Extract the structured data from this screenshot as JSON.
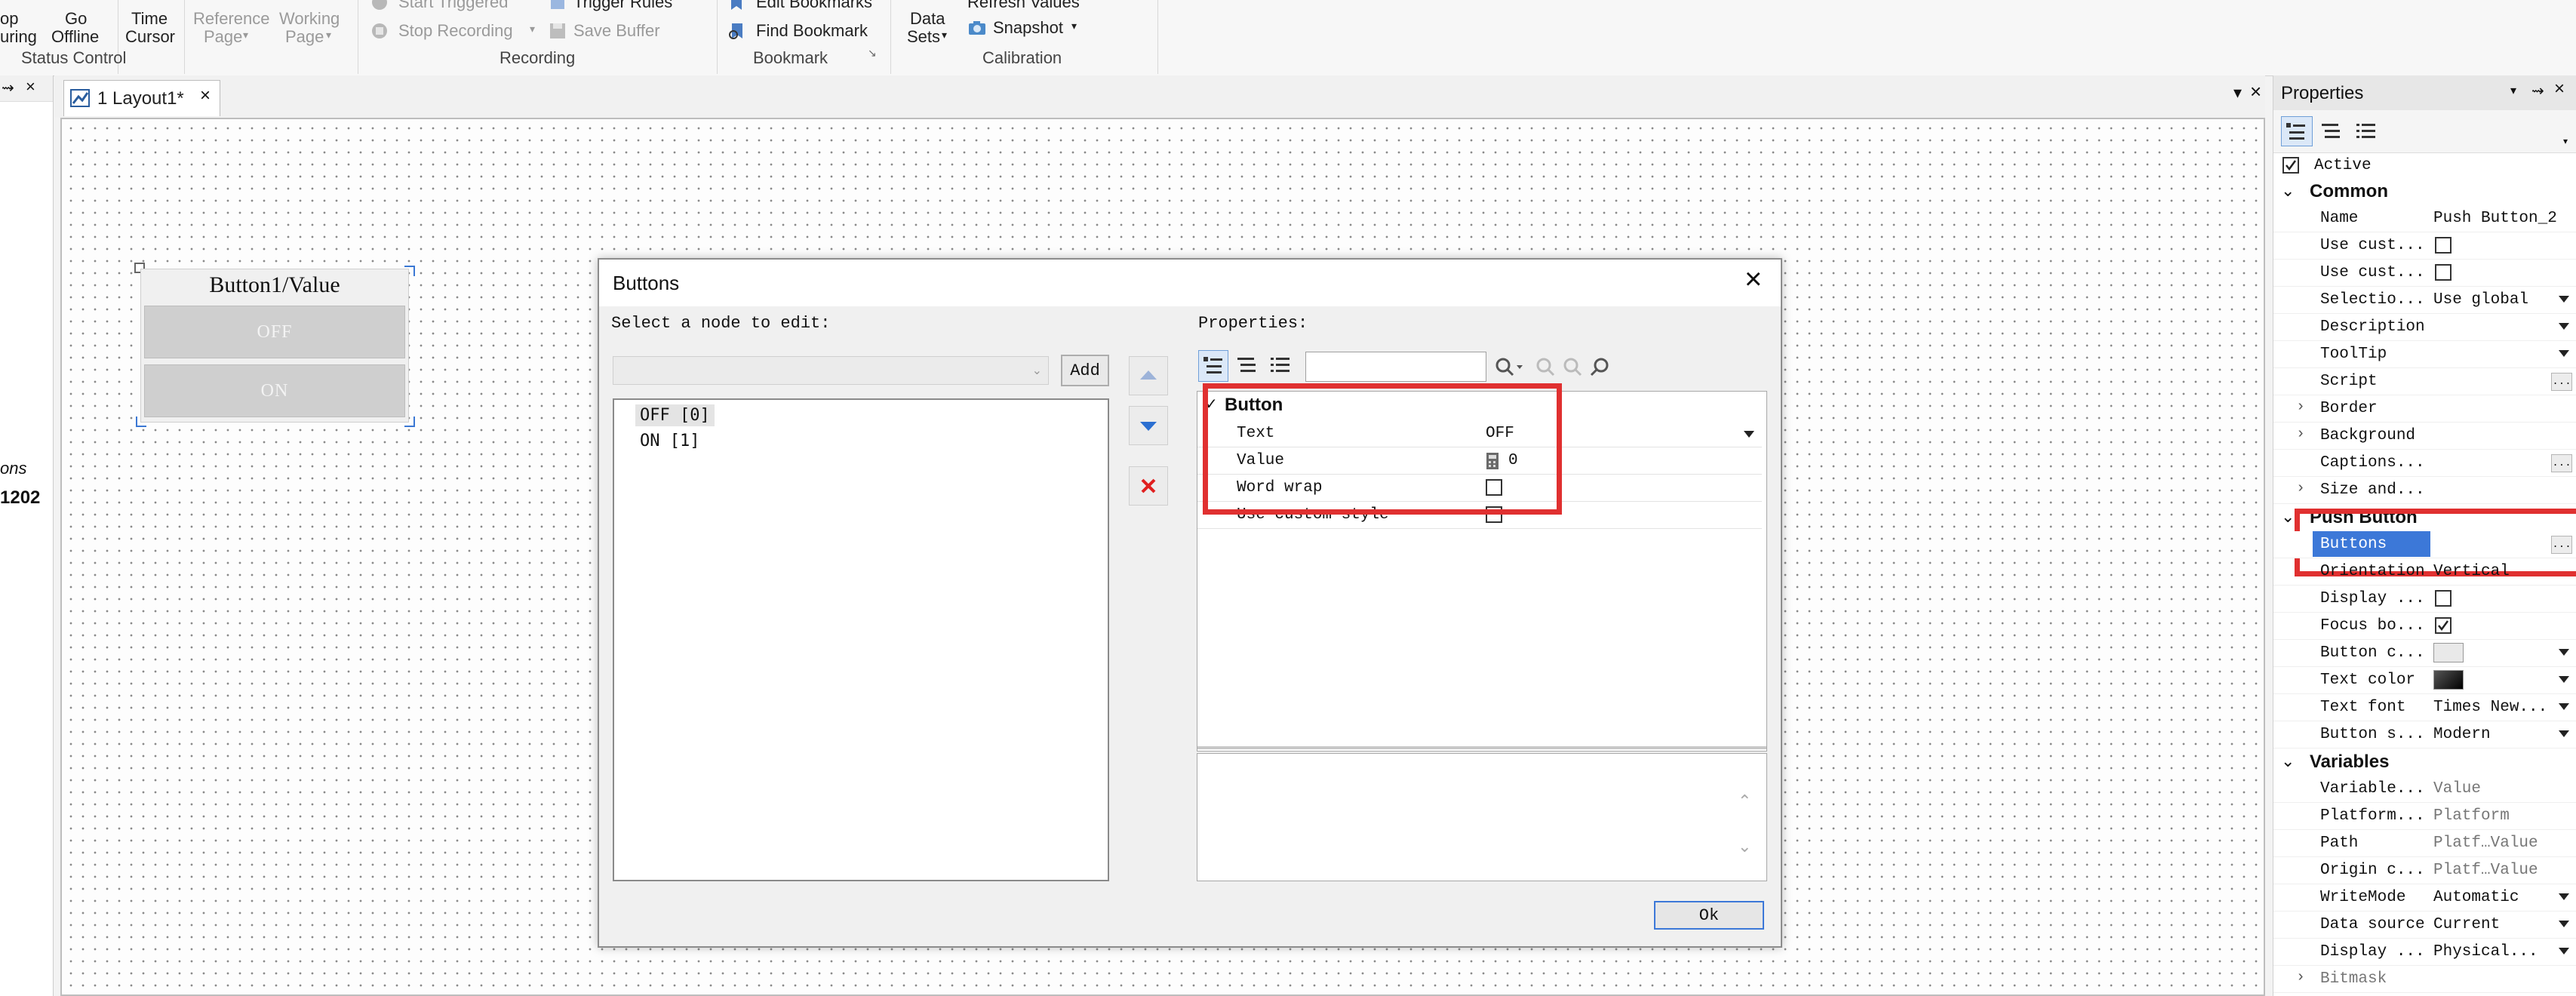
{
  "ribbon": {
    "stop_line1": "op",
    "stop_line2": "uring",
    "go_offline_line1": "Go",
    "go_offline_line2": "Offline",
    "time_cursor_line1": "Time",
    "time_cursor_line2": "Cursor",
    "reference_page_line1": "Reference",
    "reference_page_line2": "Page",
    "working_page_line1": "Working",
    "working_page_line2": "Page",
    "start_triggered": "Start Triggered",
    "trigger_rules": "Trigger Rules",
    "stop_recording": "Stop Recording",
    "save_buffer": "Save Buffer",
    "edit_bookmarks": "Edit Bookmarks",
    "find_bookmark": "Find Bookmark",
    "data_sets_line1": "Data",
    "data_sets_line2": "Sets",
    "refresh_values": "Refresh Values",
    "snapshot": "Snapshot",
    "group_status_control": "Status Control",
    "group_recording": "Recording",
    "group_bookmark": "Bookmark",
    "group_calibration": "Calibration"
  },
  "left_panel": {
    "text1": "ons",
    "text2": "1202"
  },
  "document": {
    "tab_label": "1 Layout1*"
  },
  "widget": {
    "header": "Button1/Value",
    "button_off": "OFF",
    "button_on": "ON"
  },
  "dialog": {
    "title": "Buttons",
    "select_label": "Select a node to edit:",
    "add_button": "Add",
    "nodes": [
      "OFF [0]",
      "ON [1]"
    ],
    "properties_label": "Properties:",
    "category": "Button",
    "rows": [
      {
        "name": "Text",
        "value": "OFF"
      },
      {
        "name": "Value",
        "value": "0"
      },
      {
        "name": "Word wrap",
        "value": ""
      },
      {
        "name": "Use custom style",
        "value": ""
      }
    ],
    "ok_button": "Ok"
  },
  "properties_panel": {
    "title": "Properties",
    "active_label": "Active",
    "categories": {
      "common": "Common",
      "push_button": "Push Button",
      "variables": "Variables"
    },
    "common_rows": [
      {
        "name": "Name",
        "value": "Push Button_2"
      },
      {
        "name": "Use cust...",
        "value": ""
      },
      {
        "name": "Use cust...",
        "value": ""
      },
      {
        "name": "Selectio...",
        "value": "Use global"
      },
      {
        "name": "Description",
        "value": ""
      },
      {
        "name": "ToolTip",
        "value": ""
      },
      {
        "name": "Script",
        "value": ""
      },
      {
        "name": "Border",
        "value": ""
      },
      {
        "name": "Background",
        "value": ""
      },
      {
        "name": "Captions...",
        "value": ""
      },
      {
        "name": "Size and...",
        "value": ""
      }
    ],
    "push_button_rows": [
      {
        "name": "Buttons",
        "value": ""
      },
      {
        "name": "Orientation",
        "value": "Vertical"
      },
      {
        "name": "Display ...",
        "value": ""
      },
      {
        "name": "Focus bo...",
        "value": ""
      },
      {
        "name": "Button c...",
        "value": ""
      },
      {
        "name": "Text color",
        "value": ""
      },
      {
        "name": "Text font",
        "value": "Times New..."
      },
      {
        "name": "Button s...",
        "value": "Modern"
      }
    ],
    "variables_rows": [
      {
        "name": "Variable...",
        "value": "Value"
      },
      {
        "name": "Platform...",
        "value": "Platform"
      },
      {
        "name": "Path",
        "value": "Platf…Value"
      },
      {
        "name": "Origin c...",
        "value": "Platf…Value"
      },
      {
        "name": "WriteMode",
        "value": "Automatic"
      },
      {
        "name": "Data source",
        "value": "Current"
      },
      {
        "name": "Display ...",
        "value": "Physical..."
      },
      {
        "name": "Bitmask",
        "value": ""
      }
    ]
  },
  "colors": {
    "highlight": "#e03030",
    "selection": "#3c78d8"
  }
}
